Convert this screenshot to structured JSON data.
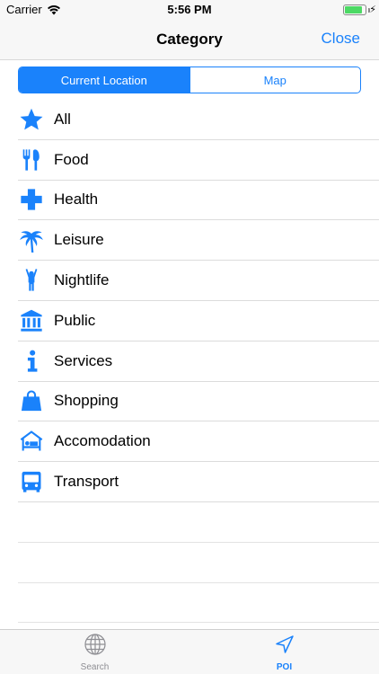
{
  "status_bar": {
    "carrier": "Carrier",
    "time": "5:56 PM",
    "battery_level": 0.85
  },
  "nav": {
    "title": "Category",
    "close_label": "Close"
  },
  "segments": [
    {
      "label": "Current Location",
      "selected": true
    },
    {
      "label": "Map",
      "selected": false
    }
  ],
  "categories": [
    {
      "label": "All",
      "icon": "star-icon"
    },
    {
      "label": "Food",
      "icon": "fork-knife-icon"
    },
    {
      "label": "Health",
      "icon": "cross-icon"
    },
    {
      "label": "Leisure",
      "icon": "palm-tree-icon"
    },
    {
      "label": "Nightlife",
      "icon": "person-arms-up-icon"
    },
    {
      "label": "Public",
      "icon": "institution-icon"
    },
    {
      "label": "Services",
      "icon": "info-icon"
    },
    {
      "label": "Shopping",
      "icon": "shopping-bag-icon"
    },
    {
      "label": "Accomodation",
      "icon": "bed-icon"
    },
    {
      "label": "Transport",
      "icon": "bus-icon"
    }
  ],
  "tabs": [
    {
      "label": "Search",
      "icon": "globe-icon",
      "active": false
    },
    {
      "label": "POI",
      "icon": "location-arrow-icon",
      "active": true
    }
  ],
  "colors": {
    "accent": "#1a82fb",
    "inactive": "#8e8e93"
  }
}
